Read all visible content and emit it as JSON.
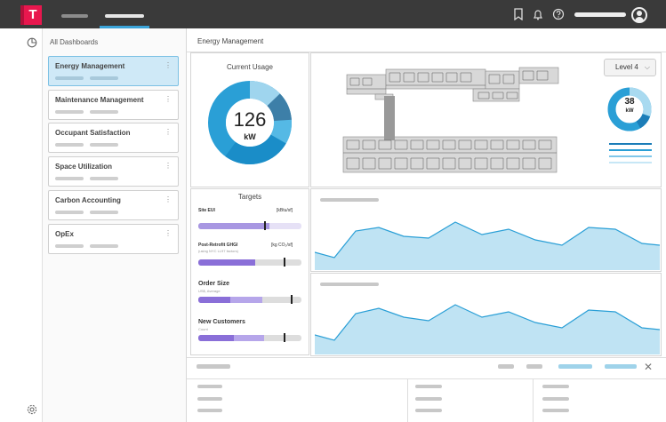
{
  "topbar": {
    "logo": "T",
    "icons": [
      "bookmark-icon",
      "bell-icon",
      "help-icon",
      "user-icon"
    ]
  },
  "rail": {
    "icons": [
      "dashboard-icon",
      "settings-icon"
    ]
  },
  "sidebar": {
    "title": "All Dashboards",
    "items": [
      {
        "label": "Energy Management",
        "active": true
      },
      {
        "label": "Maintenance Management",
        "active": false
      },
      {
        "label": "Occupant Satisfaction",
        "active": false
      },
      {
        "label": "Space Utilization",
        "active": false
      },
      {
        "label": "Carbon Accounting",
        "active": false
      },
      {
        "label": "OpEx",
        "active": false
      }
    ],
    "kebab": "⋮"
  },
  "main": {
    "title": "Energy Management",
    "current_usage": {
      "title": "Current Usage",
      "value": "126",
      "unit": "kW"
    },
    "floor": {
      "level_label": "Level 4",
      "value": "38",
      "unit": "kW"
    },
    "targets": {
      "title": "Targets",
      "site_eui": {
        "label": "Site EUI",
        "unit": "[kBtu/sf]"
      },
      "post_retrofit": {
        "label": "Post-Retrofit GHGI",
        "unit": "[kg CO₂/sf]",
        "sub": "(using NYC LL97 factors)"
      },
      "order_size": {
        "label": "Order Size",
        "sub": "US$, Average"
      },
      "new_customers": {
        "label": "New Customers",
        "sub": "Count"
      }
    }
  },
  "colors": {
    "topbar": "#3a3a3a",
    "brand": "#e8174e",
    "accent": "#3aa3d8",
    "active_card": "#cfe9f7",
    "area_fill": "#bfe3f3",
    "area_line": "#2a9fd6",
    "target_fill": "#8a6fd8"
  }
}
